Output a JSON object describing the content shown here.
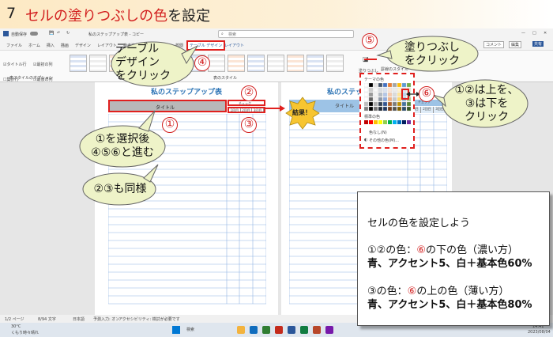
{
  "banner": {
    "number": "7",
    "title_red": "セルの塗りつぶしの色",
    "title_rest": "を設定"
  },
  "window": {
    "autosave": "自動保存",
    "doc_title": "私のステップアップ表 - コピー",
    "search_placeholder": "検索"
  },
  "tabs": [
    "ファイル",
    "ホーム",
    "挿入",
    "描画",
    "デザイン",
    "レイアウト",
    "参考資料",
    "差し込み文書",
    "校閲",
    "表示",
    "ヘルプ"
  ],
  "active_tab": "テーブル デザイン",
  "extra_tab": "レイアウト",
  "tab_right": {
    "comment": "コメント",
    "edit": "編集",
    "share": "共有"
  },
  "ribbon": {
    "options": [
      "タイトル行",
      "最初の列",
      "集計行",
      "最後の列",
      "縞模様 (行)",
      "縞模様 (列)"
    ],
    "options_group": "表スタイルのオプション",
    "styles_group": "表のスタイル",
    "shading_label": "塗りつぶし",
    "border_label": "罫線のスタイル"
  },
  "document": {
    "heading": "私のステップアップ表",
    "title_cell": "タイトル",
    "check_header": "チェック",
    "check_sub": [
      "1回目",
      "2回目",
      "3回目"
    ],
    "page2_heading": "私のステップ",
    "page2_title_cell": "タイトル",
    "page2_check_header": "チェック",
    "page2_check_sub": [
      "1回目",
      "2回目",
      "3回目"
    ]
  },
  "dropdown": {
    "theme_colors": "テーマの色",
    "standard_colors": "標準の色",
    "no_color": "色なし(N)",
    "more_colors": "その他の色(M)...",
    "theme_palette": [
      "#ffffff",
      "#000000",
      "#e7e6e6",
      "#44546a",
      "#4472c4",
      "#ed7d31",
      "#a5a5a5",
      "#ffc000",
      "#5b9bd5",
      "#70ad47"
    ],
    "standard_palette": [
      "#c00000",
      "#ff0000",
      "#ffc000",
      "#ffff00",
      "#92d050",
      "#00b050",
      "#00b0f0",
      "#0070c0",
      "#002060",
      "#7030a0"
    ]
  },
  "callouts": {
    "c1_line1": "①を選択後",
    "c1_line2": "④⑤⑥と進む",
    "c2": "②③も同様",
    "c3_line1": "テーブル",
    "c3_line2": "デザイン",
    "c3_line3": "をクリック",
    "c4_line1": "塗りつぶし",
    "c4_line2": "をクリック",
    "c5_line1": "①②は上を、",
    "c5_line2": "③は下を",
    "c5_line3": "クリック",
    "result": "結果！"
  },
  "markers": [
    "①",
    "②",
    "③",
    "④",
    "⑤",
    "⑥"
  ],
  "info": {
    "line1": "セルの色を設定しよう",
    "line2_a": "①②の色：",
    "line2_b": "⑥",
    "line2_c": "の下の色（濃い方）",
    "line3": "青、アクセント5、白＋基本色60%",
    "line4_a": "③の色：",
    "line4_b": "⑥",
    "line4_c": "の上の色（薄い方）",
    "line5": "青、アクセント5、白＋基本色80%"
  },
  "status": {
    "page": "1/2 ページ",
    "words": "8/94 文字",
    "lang": "日本語",
    "predict": "予測入力: オン",
    "access": "アクセシビリティ: 検討が必要です"
  },
  "taskbar": {
    "weather_temp": "30°C",
    "weather_desc": "くもり時々晴れ",
    "search": "検索",
    "time": "14:41",
    "date": "2023/08/04"
  },
  "colors": {
    "accent_red": "#e0201e",
    "banner_orange": "#fde9c4",
    "callout_green": "#eef3c8",
    "result_star": "#f7c531",
    "word_blue": "#2b579a"
  }
}
